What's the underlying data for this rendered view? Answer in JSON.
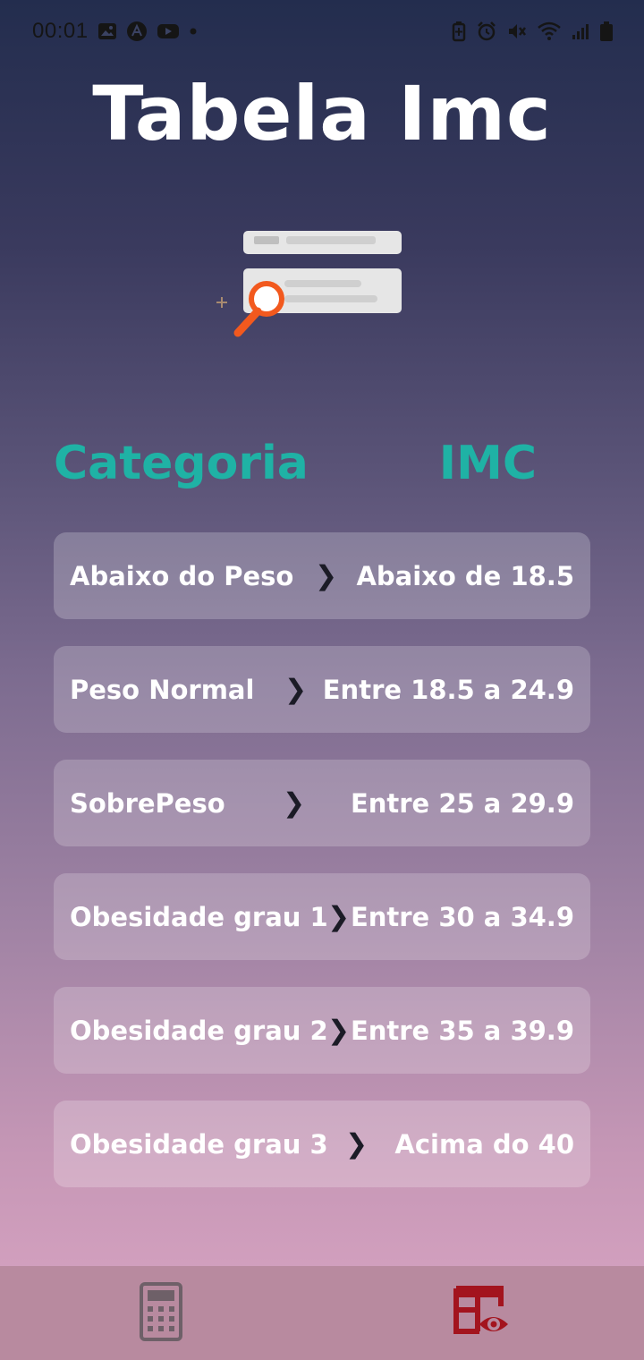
{
  "status_bar": {
    "time": "00:01",
    "left_icons": [
      "gallery-icon",
      "app-icon",
      "youtube-icon",
      "dot-icon"
    ],
    "right_icons": [
      "battery-saver-icon",
      "alarm-icon",
      "mute-icon",
      "wifi-icon",
      "signal-icon",
      "battery-icon"
    ]
  },
  "page": {
    "title": "Tabela Imc",
    "illustration": "search-list-illustration"
  },
  "table": {
    "header_category": "Categoria",
    "header_imc": "IMC",
    "rows": [
      {
        "category": "Abaixo do Peso",
        "value": "Abaixo de 18.5"
      },
      {
        "category": "Peso Normal",
        "value": "Entre 18.5 a 24.9"
      },
      {
        "category": "SobrePeso",
        "value": "Entre 25 a 29.9"
      },
      {
        "category": "Obesidade grau 1",
        "value": "Entre 30 a 34.9"
      },
      {
        "category": "Obesidade grau 2",
        "value": "Entre 35 a 39.9"
      },
      {
        "category": "Obesidade grau 3",
        "value": "Acima do 40"
      }
    ]
  },
  "bottom_nav": {
    "items": [
      {
        "icon": "calculator-icon",
        "active": false
      },
      {
        "icon": "table-view-icon",
        "active": true
      }
    ],
    "active_color": "#a3141e",
    "inactive_color": "#6e6068"
  },
  "colors": {
    "accent": "#1fb2a5",
    "row_text": "#ffffff",
    "chevron": "#1b1b26"
  }
}
